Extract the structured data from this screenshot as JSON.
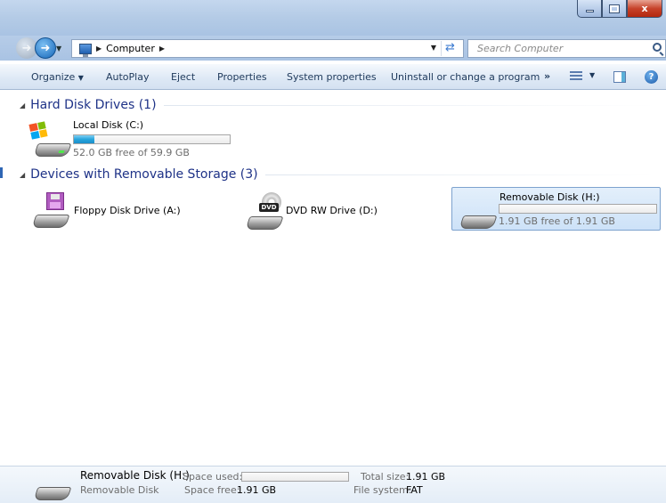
{
  "window": {
    "controls": {
      "minimize": "",
      "maximize": "",
      "close": "x"
    }
  },
  "nav": {
    "breadcrumb": [
      "Computer"
    ],
    "search_placeholder": "Search Computer"
  },
  "toolbar": {
    "organize": "Organize",
    "autoplay": "AutoPlay",
    "eject": "Eject",
    "properties": "Properties",
    "system_properties": "System properties",
    "uninstall": "Uninstall or change a program",
    "more": "»"
  },
  "groups": {
    "hard_disks": {
      "header": "Hard Disk Drives (1)",
      "drives": [
        {
          "name": "Local Disk (C:)",
          "free_text": "52.0 GB free of 59.9 GB",
          "used_fraction": 0.13
        }
      ]
    },
    "removable": {
      "header": "Devices with Removable Storage (3)",
      "drives": [
        {
          "name": "Floppy Disk Drive (A:)",
          "icon": "floppy-drive-icon"
        },
        {
          "name": "DVD RW Drive (D:)",
          "icon": "dvd-drive-icon",
          "badge": "DVD"
        },
        {
          "name": "Removable Disk (H:)",
          "icon": "removable-disk-icon",
          "free_text": "1.91 GB free of 1.91 GB",
          "used_fraction": 0.0
        }
      ]
    }
  },
  "details": {
    "name": "Removable Disk (H:)",
    "type": "Removable Disk",
    "space_used_label": "Space used:",
    "space_free_label": "Space free:",
    "space_free_value": "1.91 GB",
    "total_size_label": "Total size:",
    "total_size_value": "1.91 GB",
    "filesystem_label": "File system:",
    "filesystem_value": "FAT",
    "used_fraction": 0.0
  },
  "colors": {
    "accent": "#1e3287",
    "bar_fill": "#27a5dc",
    "selection": "#cde2f8"
  }
}
